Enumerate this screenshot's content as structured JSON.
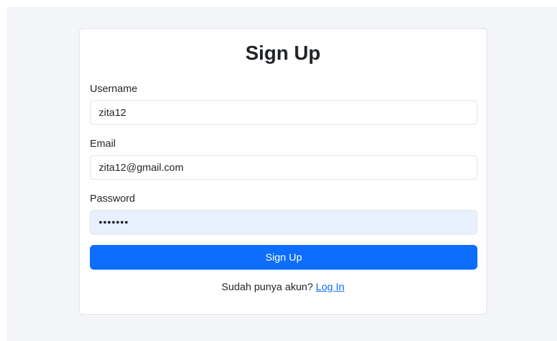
{
  "form": {
    "title": "Sign Up",
    "username": {
      "label": "Username",
      "value": "zita12"
    },
    "email": {
      "label": "Email",
      "value": "zita12@gmail.com"
    },
    "password": {
      "label": "Password",
      "value": "•••••••"
    },
    "submit_label": "Sign Up"
  },
  "footer": {
    "prompt": "Sudah punya akun?",
    "link_label": "Log In"
  },
  "colors": {
    "background": "#f4f5f8",
    "primary": "#0d6efd",
    "autofill": "#e8f0fe"
  }
}
